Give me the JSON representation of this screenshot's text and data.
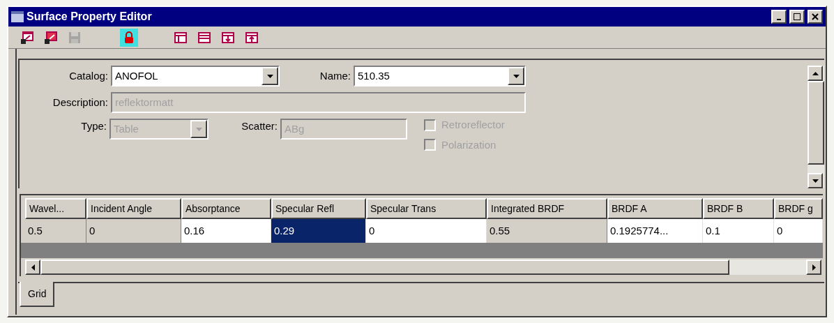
{
  "window": {
    "title": "Surface Property Editor"
  },
  "toolbar": [
    {
      "kind": "open",
      "disabled": false,
      "pressed": false
    },
    {
      "kind": "import",
      "disabled": false,
      "pressed": false
    },
    {
      "kind": "save",
      "disabled": true,
      "pressed": false
    },
    {
      "kind": "lock",
      "disabled": false,
      "pressed": true
    },
    {
      "kind": "layout-left",
      "disabled": false,
      "pressed": false
    },
    {
      "kind": "layout-split",
      "disabled": false,
      "pressed": false
    },
    {
      "kind": "layout-down",
      "disabled": false,
      "pressed": false
    },
    {
      "kind": "layout-up",
      "disabled": false,
      "pressed": false
    }
  ],
  "form": {
    "catalog": {
      "label": "Catalog:",
      "value": "ANOFOL",
      "disabled": false
    },
    "name": {
      "label": "Name:",
      "value": "510.35",
      "disabled": false
    },
    "description": {
      "label": "Description:",
      "value": "reflektormatt",
      "disabled": true
    },
    "type": {
      "label": "Type:",
      "value": "Table",
      "disabled": true
    },
    "scatter": {
      "label": "Scatter:",
      "value": "ABg",
      "disabled": true
    },
    "checkboxes": [
      {
        "label": "Retroreflector",
        "checked": false,
        "disabled": true
      },
      {
        "label": "Polarization",
        "checked": false,
        "disabled": true
      }
    ]
  },
  "grid": {
    "columns": [
      "Wavel...",
      "Incident Angle",
      "Absorptance",
      "Specular Refl",
      "Specular Trans",
      "Integrated BRDF",
      "BRDF A",
      "BRDF B",
      "BRDF g"
    ],
    "rows": [
      {
        "cells": [
          {
            "text": "0.5",
            "editable": false,
            "selected": false
          },
          {
            "text": "0",
            "editable": false,
            "selected": false
          },
          {
            "text": "0.16",
            "editable": true,
            "selected": false
          },
          {
            "text": "0.29",
            "editable": true,
            "selected": true
          },
          {
            "text": "0",
            "editable": true,
            "selected": false
          },
          {
            "text": "0.55",
            "editable": false,
            "selected": false
          },
          {
            "text": "0.1925774...",
            "editable": true,
            "selected": false
          },
          {
            "text": "0.1",
            "editable": true,
            "selected": false
          },
          {
            "text": "0",
            "editable": true,
            "selected": false
          }
        ]
      }
    ]
  },
  "tabs": [
    {
      "label": "Grid",
      "selected": true
    }
  ]
}
